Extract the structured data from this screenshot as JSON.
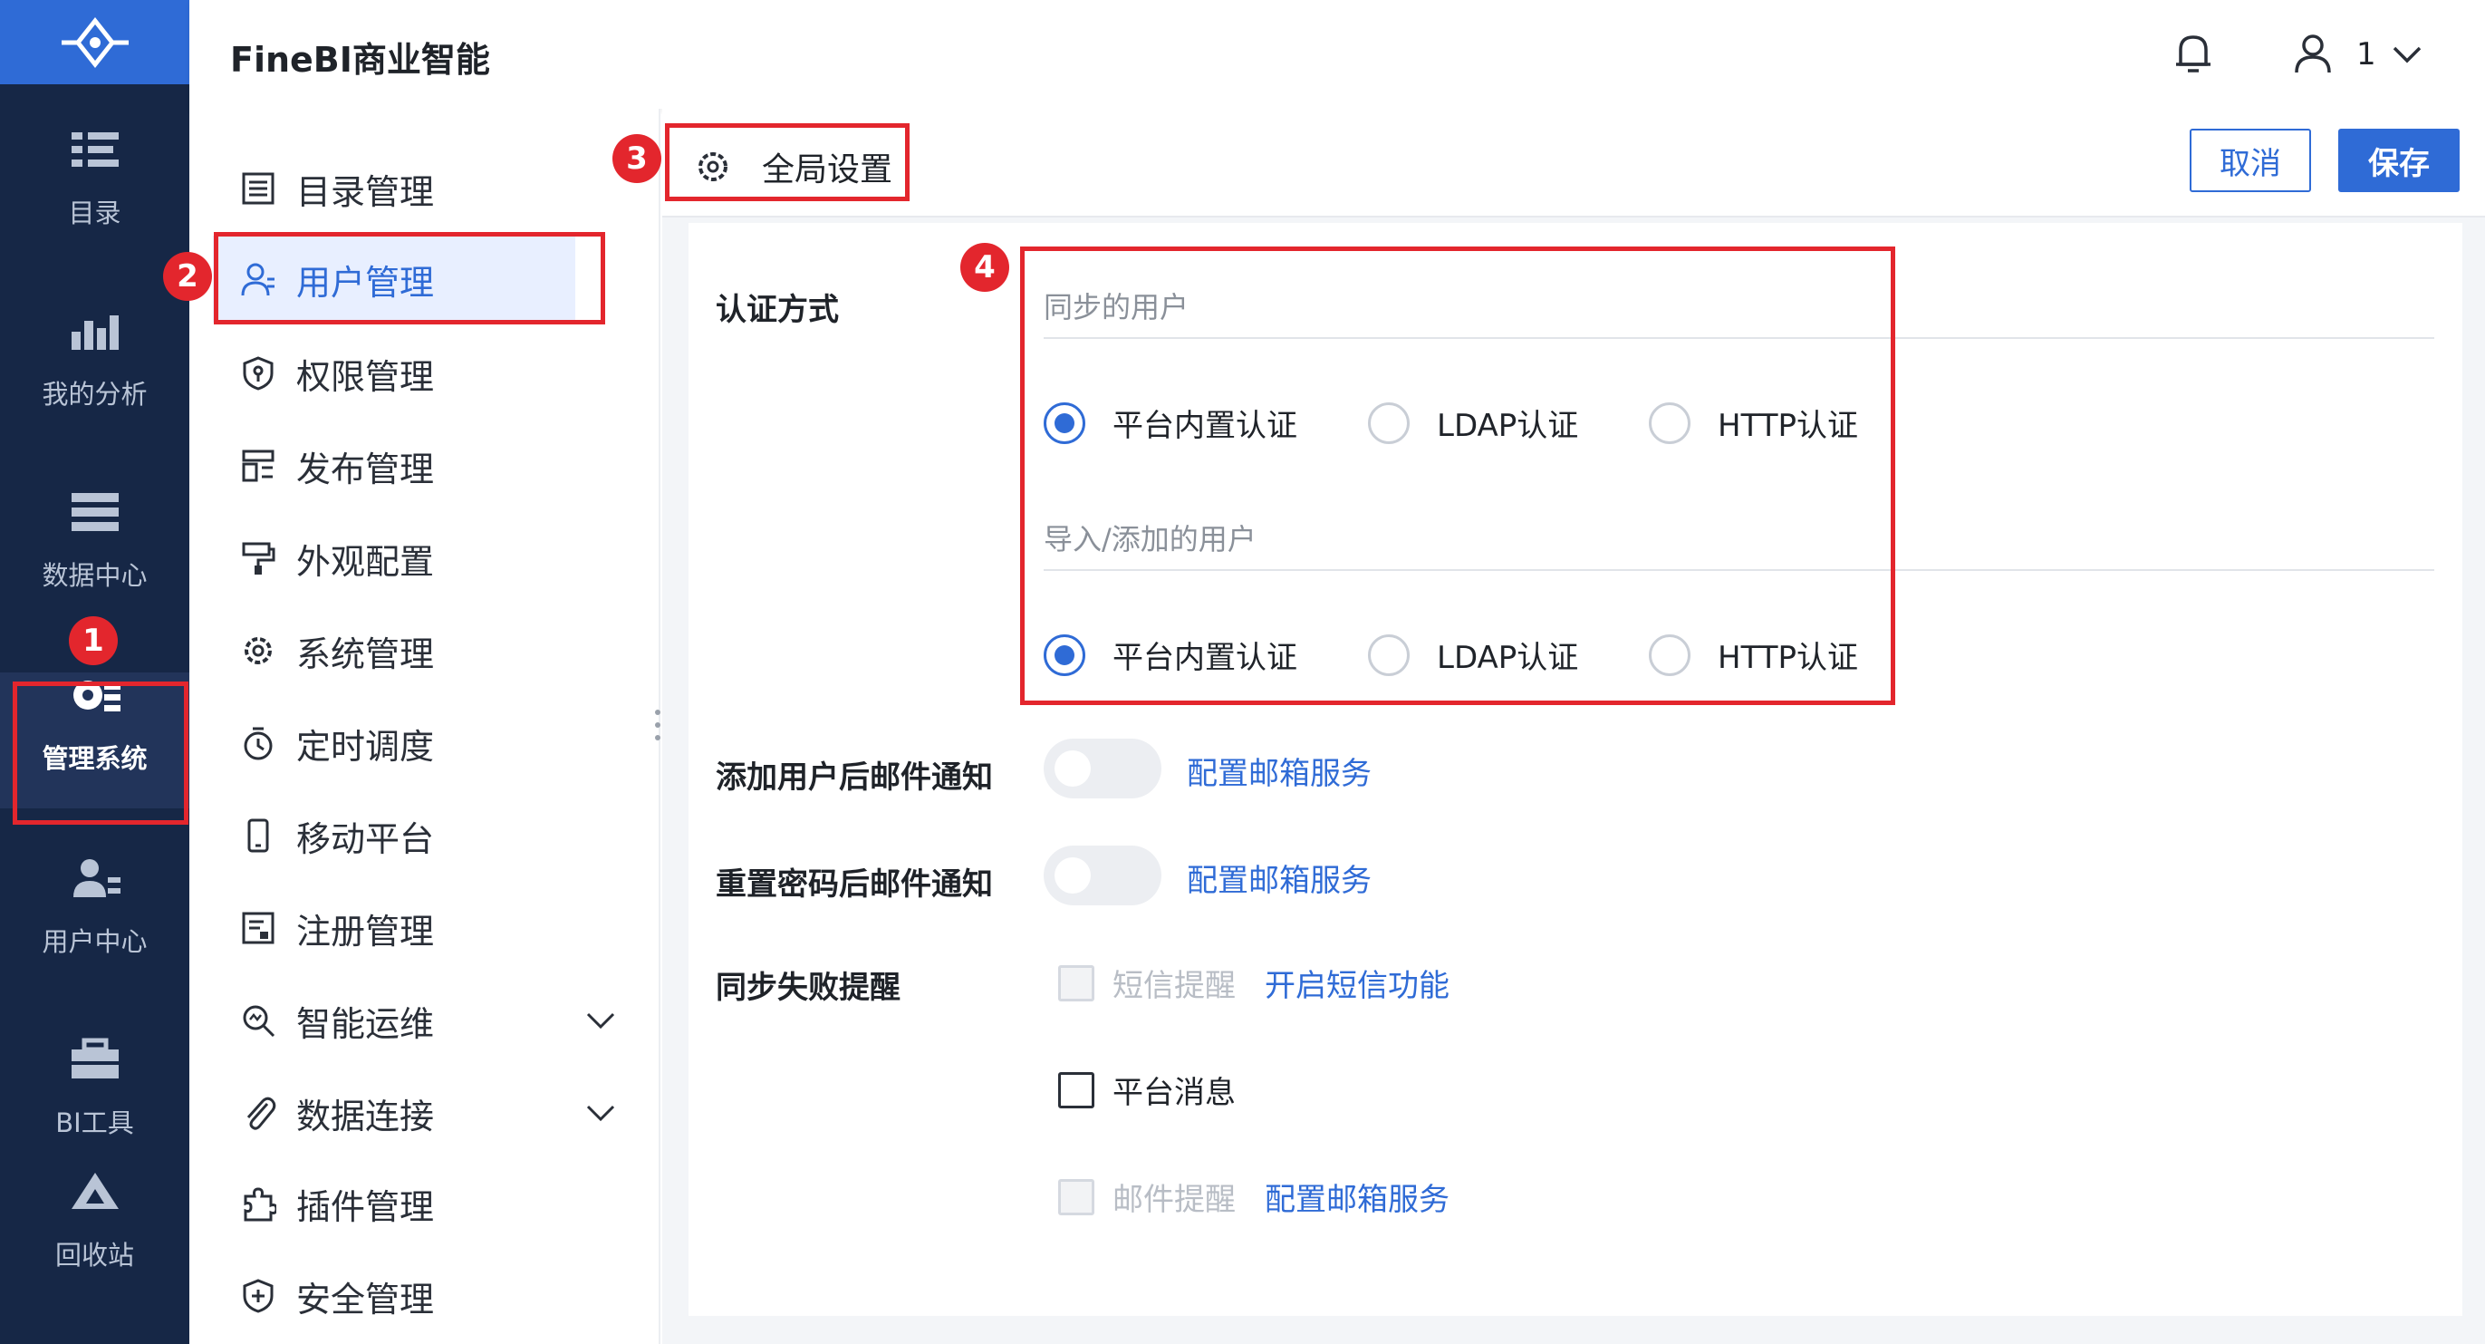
{
  "app": {
    "title": "FineBI商业智能"
  },
  "header": {
    "user_name": "1"
  },
  "rail": {
    "items": [
      {
        "label": "目录"
      },
      {
        "label": "我的分析"
      },
      {
        "label": "数据中心"
      },
      {
        "label": "管理系统"
      },
      {
        "label": "用户中心"
      },
      {
        "label": "BI工具"
      },
      {
        "label": "回收站"
      }
    ]
  },
  "menu": {
    "items": [
      {
        "label": "目录管理"
      },
      {
        "label": "用户管理"
      },
      {
        "label": "权限管理"
      },
      {
        "label": "发布管理"
      },
      {
        "label": "外观配置"
      },
      {
        "label": "系统管理"
      },
      {
        "label": "定时调度"
      },
      {
        "label": "移动平台"
      },
      {
        "label": "注册管理"
      },
      {
        "label": "智能运维"
      },
      {
        "label": "数据连接"
      },
      {
        "label": "插件管理"
      },
      {
        "label": "安全管理"
      }
    ]
  },
  "content": {
    "tab_title": "全局设置",
    "cancel_label": "取消",
    "save_label": "保存",
    "auth": {
      "label": "认证方式",
      "synced_users_label": "同步的用户",
      "imported_users_label": "导入/添加的用户",
      "options": [
        "平台内置认证",
        "LDAP认证",
        "HTTP认证"
      ]
    },
    "email_after_add": {
      "label": "添加用户后邮件通知",
      "link": "配置邮箱服务"
    },
    "email_after_reset": {
      "label": "重置密码后邮件通知",
      "link": "配置邮箱服务"
    },
    "sync_fail": {
      "label": "同步失败提醒",
      "sms_label": "短信提醒",
      "sms_link": "开启短信功能",
      "platform_label": "平台消息",
      "mail_label": "邮件提醒",
      "mail_link": "配置邮箱服务"
    }
  },
  "annotations": [
    "1",
    "2",
    "3",
    "4"
  ],
  "colors": {
    "accent": "#2f6bd6",
    "rail": "#162746",
    "annotation": "#e3262d"
  }
}
